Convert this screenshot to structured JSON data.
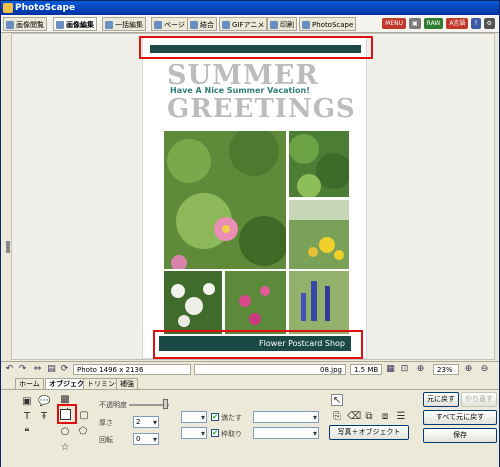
{
  "app": {
    "title": "PhotoScape"
  },
  "tabs": [
    {
      "label": "画像閲覧"
    },
    {
      "label": "画像編集"
    },
    {
      "label": "一括編集"
    },
    {
      "label": "ページ"
    },
    {
      "label": "結合"
    },
    {
      "label": "GIFアニメ"
    },
    {
      "label": "印刷"
    },
    {
      "label": "PhotoScape"
    }
  ],
  "top_icons": [
    {
      "label": "MENU",
      "color": "#c0392b"
    },
    {
      "label": "▣",
      "color": "#7a7a7a"
    },
    {
      "label": "RAW",
      "color": "#2e7d32"
    },
    {
      "label": "A言語",
      "color": "#c0392b"
    },
    {
      "label": "?",
      "color": "#3b5ba5"
    },
    {
      "label": "⚙",
      "color": "#555555"
    }
  ],
  "postcard": {
    "title_line1": "SUMMER",
    "subtitle": "Have A Nice Summer Vacation!",
    "title_line2": "GREETINGS",
    "footer": "Flower Postcard Shop",
    "bar_color": "#1b4a46"
  },
  "status": {
    "photo_size": "Photo 1496 x 2136",
    "filename": "08.jpg",
    "filesize": "1.5 MB",
    "zoom": "23%"
  },
  "panel_tabs": [
    {
      "label": "ホーム"
    },
    {
      "label": "オブジェクト"
    },
    {
      "label": "トリミング"
    },
    {
      "label": "補強"
    }
  ],
  "panel": {
    "opacity_label": "不透明度",
    "thickness_label": "厚さ",
    "thickness_value": "2",
    "rotate_label": "回転",
    "rotate_value": "0",
    "fill_label": "満たす",
    "border_label": "枠取り",
    "photo_object_button": "写真＋オブジェクト",
    "undo_button": "元に戻す",
    "redo_button": "やり直す",
    "undo_all_button": "すべて元に戻す",
    "save_button": "保存"
  }
}
